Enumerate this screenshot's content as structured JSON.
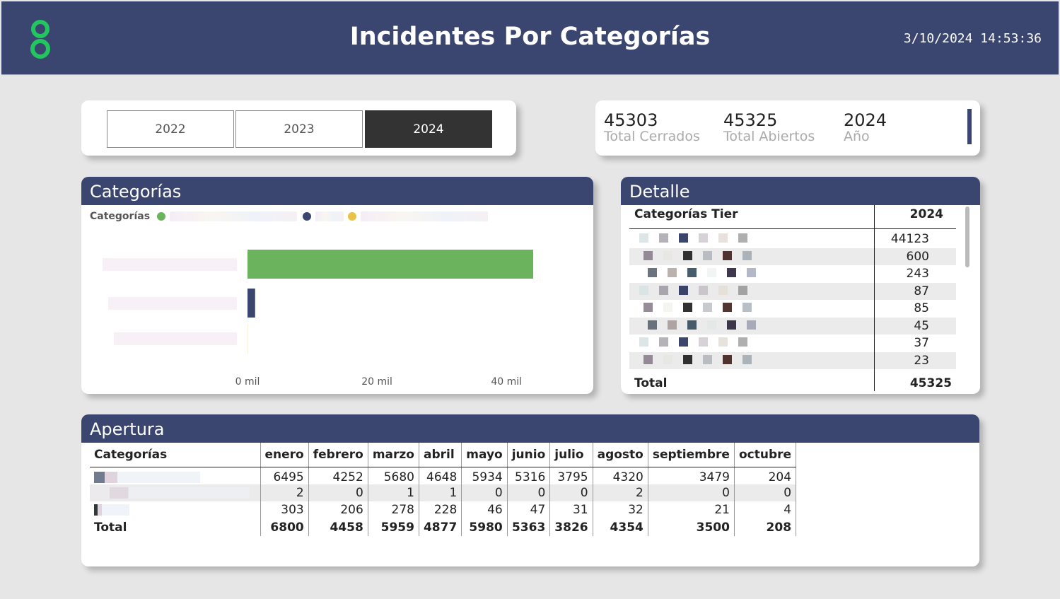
{
  "header": {
    "title": "Incidentes Por Categorías",
    "datetime": "3/10/2024 14:53:36",
    "logo_color": "#22c55e"
  },
  "year_slicer": {
    "options": [
      "2022",
      "2023",
      "2024"
    ],
    "selected": "2024"
  },
  "kpis": [
    {
      "value": "45303",
      "label": "Total Cerrados"
    },
    {
      "value": "45325",
      "label": "Total Abiertos"
    },
    {
      "value": "2024",
      "label": "Año"
    }
  ],
  "categorias_panel": {
    "title": "Categorías",
    "legend_label": "Categorías",
    "legend_colors": [
      "#6bb35c",
      "#3a4570",
      "#e9c24a"
    ]
  },
  "chart_data": {
    "type": "bar",
    "orientation": "horizontal",
    "categories": [
      "",
      "",
      ""
    ],
    "values": [
      44123,
      1178,
      24
    ],
    "xlim": [
      0,
      44123
    ],
    "x_tick_labels": [
      "0 mil",
      "20 mil",
      "40 mil"
    ],
    "colors": [
      "#6bb35c",
      "#3a4570",
      "#e9c24a"
    ],
    "legend_position": "top-left"
  },
  "detalle": {
    "title": "Detalle",
    "col_category": "Categorías Tier",
    "col_year": "2024",
    "values": [
      "44123",
      "600",
      "243",
      "87",
      "85",
      "45",
      "37",
      "23"
    ],
    "total_label": "Total",
    "total_value": "45325"
  },
  "apertura": {
    "title": "Apertura",
    "col_category": "Categorías",
    "months": [
      "enero",
      "febrero",
      "marzo",
      "abril",
      "mayo",
      "junio",
      "julio",
      "agosto",
      "septiembre",
      "octubre"
    ],
    "rows": [
      [
        "6495",
        "4252",
        "5680",
        "4648",
        "5934",
        "5316",
        "3795",
        "4320",
        "3479",
        "204"
      ],
      [
        "2",
        "0",
        "1",
        "1",
        "0",
        "0",
        "0",
        "2",
        "0",
        "0"
      ],
      [
        "303",
        "206",
        "278",
        "228",
        "46",
        "47",
        "31",
        "32",
        "21",
        "4"
      ]
    ],
    "total_label": "Total",
    "totals": [
      "6800",
      "4458",
      "5959",
      "4877",
      "5980",
      "5363",
      "3826",
      "4354",
      "3500",
      "208"
    ]
  }
}
